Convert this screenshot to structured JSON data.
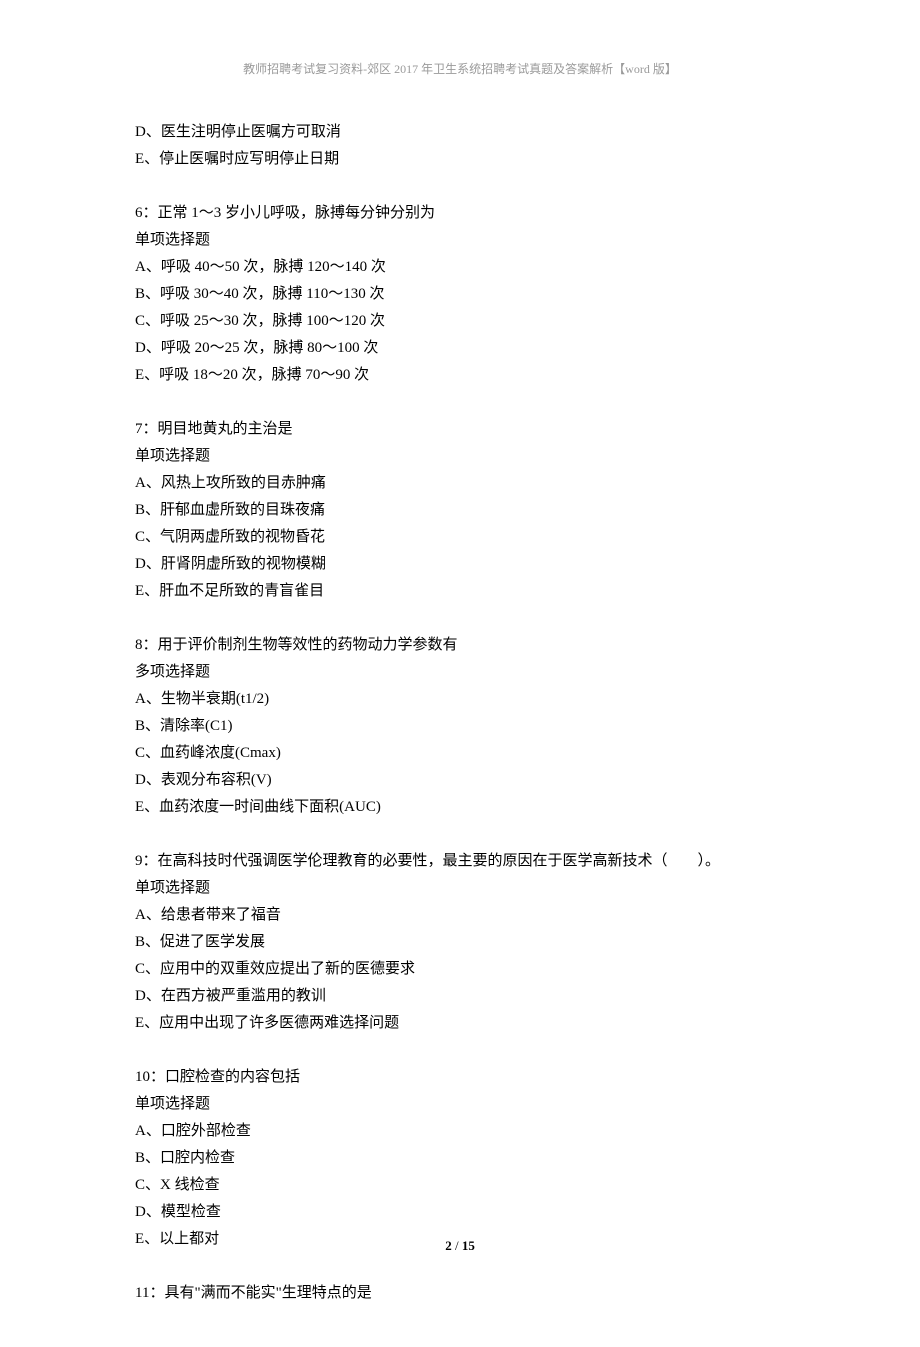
{
  "header": "教师招聘考试复习资料-郊区 2017 年卫生系统招聘考试真题及答案解析【word 版】",
  "q5": {
    "optD": "D、医生注明停止医嘱方可取消",
    "optE": "E、停止医嘱时应写明停止日期"
  },
  "q6": {
    "stem": "6：正常 1～3 岁小儿呼吸，脉搏每分钟分别为",
    "type": "单项选择题",
    "optA": "A、呼吸 40～50 次，脉搏 120～140 次",
    "optB": "B、呼吸 30～40 次，脉搏 110～130 次",
    "optC": "C、呼吸 25～30 次，脉搏 100～120 次",
    "optD": "D、呼吸 20～25 次，脉搏 80～100 次",
    "optE": "E、呼吸 18～20 次，脉搏 70～90 次"
  },
  "q7": {
    "stem": "7：明目地黄丸的主治是",
    "type": "单项选择题",
    "optA": "A、风热上攻所致的目赤肿痛",
    "optB": "B、肝郁血虚所致的目珠夜痛",
    "optC": "C、气阴两虚所致的视物昏花",
    "optD": "D、肝肾阴虚所致的视物模糊",
    "optE": "E、肝血不足所致的青盲雀目"
  },
  "q8": {
    "stem": "8：用于评价制剂生物等效性的药物动力学参数有",
    "type": "多项选择题",
    "optA": "A、生物半衰期(t1/2)",
    "optB": "B、清除率(C1)",
    "optC": "C、血药峰浓度(Cmax)",
    "optD": "D、表观分布容积(V)",
    "optE": "E、血药浓度一时间曲线下面积(AUC)"
  },
  "q9": {
    "stem": "9：在高科技时代强调医学伦理教育的必要性，最主要的原因在于医学高新技术（　　）。",
    "type": "单项选择题",
    "optA": "A、给患者带来了福音",
    "optB": "B、促进了医学发展",
    "optC": "C、应用中的双重效应提出了新的医德要求",
    "optD": "D、在西方被严重滥用的教训",
    "optE": "E、应用中出现了许多医德两难选择问题"
  },
  "q10": {
    "stem": "10：口腔检查的内容包括",
    "type": "单项选择题",
    "optA": "A、口腔外部检查",
    "optB": "B、口腔内检查",
    "optC": "C、X 线检查",
    "optD": "D、模型检查",
    "optE": "E、以上都对"
  },
  "q11": {
    "stem": "11：具有\"满而不能实\"生理特点的是"
  },
  "footer": {
    "page": "2",
    "sep": " / ",
    "total": "15"
  }
}
